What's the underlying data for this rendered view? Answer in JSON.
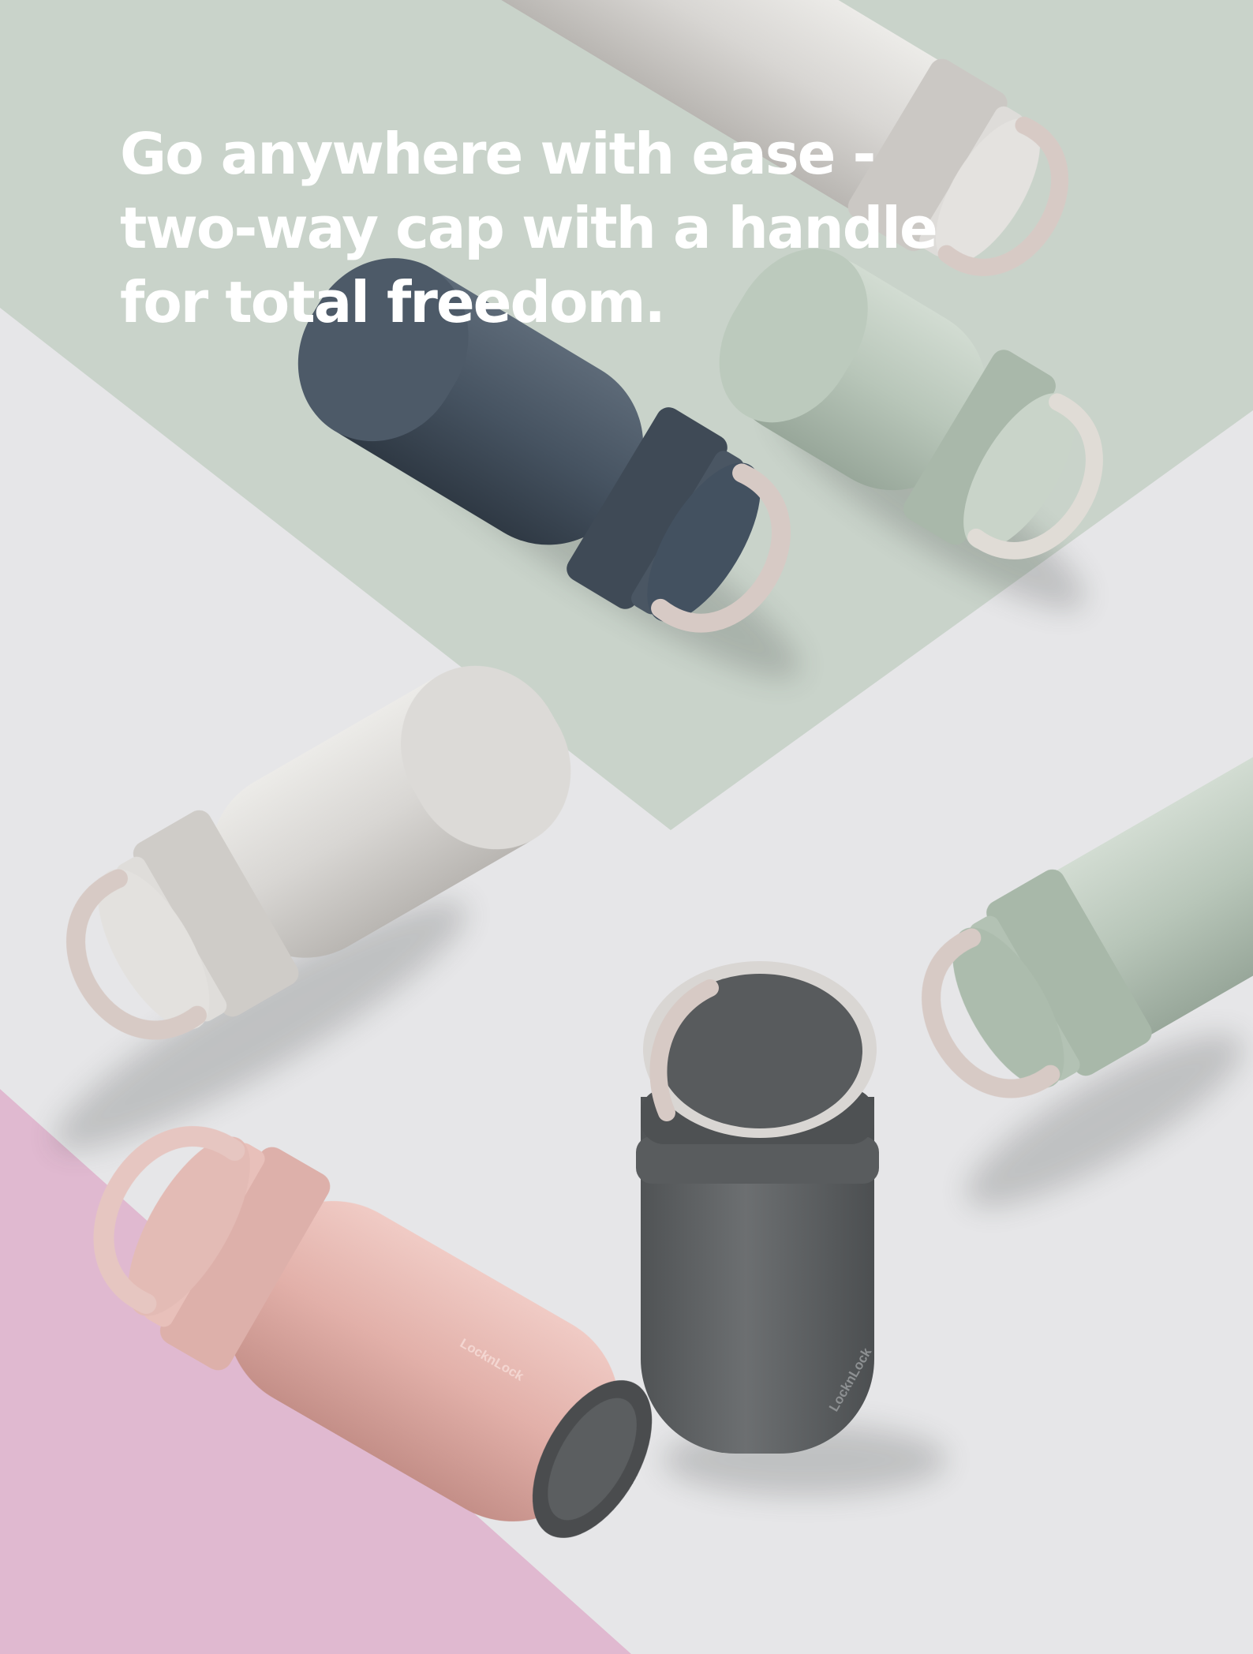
{
  "headline": {
    "lines": [
      "Go anywhere with ease -",
      "two-way cap with a handle",
      "for total freedom."
    ]
  },
  "brand_mark": "LocknLock",
  "colors": {
    "sage_paper": "#c9d3ca",
    "white_surface": "#e6e6e8",
    "pink_paper": "#e0b9d0",
    "bottle_stone": "#d8d6d3",
    "bottle_sage": "#b8c6b9",
    "bottle_navy": "#475462",
    "bottle_charcoal": "#626567",
    "bottle_pink": "#e6b4ad",
    "handle_beige": "#d7cac5"
  },
  "icons": {
    "bottle_handle": "ring-handle-icon"
  }
}
